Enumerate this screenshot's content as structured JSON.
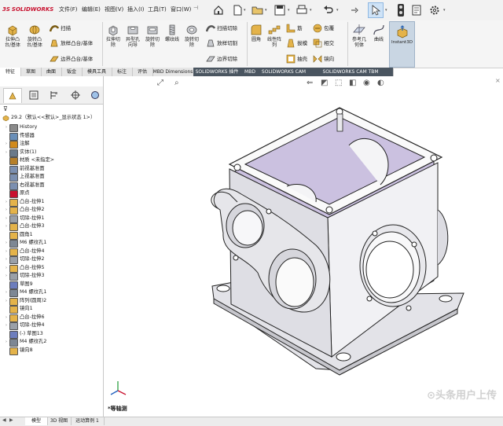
{
  "app": {
    "logo_text": "SOLIDWORKS",
    "logo_mark": "3S"
  },
  "menu": [
    "文件(F)",
    "编辑(E)",
    "视图(V)",
    "插入(I)",
    "工具(T)",
    "窗口(W)"
  ],
  "ribbon": {
    "groups": [
      {
        "label": "拉伸凸\n台/基体"
      },
      {
        "label": "旋转凸\n台/基体"
      },
      {
        "label": "扫描"
      },
      {
        "label": "放样凸台/基体"
      },
      {
        "label": "边界凸台/基体"
      },
      {
        "label": "拉伸切\n除"
      },
      {
        "label": "异型孔\n向导"
      },
      {
        "label": "旋转切\n除"
      },
      {
        "label": "螺纹线"
      },
      {
        "label": "旋转切\n除"
      },
      {
        "label": "扫描切除"
      },
      {
        "label": "放样切割"
      },
      {
        "label": "边界切除"
      },
      {
        "label": "圆角"
      },
      {
        "label": "线性阵\n列"
      },
      {
        "label": "筋"
      },
      {
        "label": "拔模"
      },
      {
        "label": "抽壳"
      },
      {
        "label": "包覆"
      },
      {
        "label": "相交"
      },
      {
        "label": "镜向"
      },
      {
        "label": "参考几\n何体"
      },
      {
        "label": "曲线"
      },
      {
        "label": "Instant3D"
      }
    ]
  },
  "tabs": [
    "特征",
    "草图",
    "曲面",
    "钣金",
    "模具工具",
    "标注",
    "评估",
    "MBD Dimensions",
    "SOLIDWORKS 插件",
    "MBD",
    "SOLIDWORKS CAM",
    "SOLIDWORKS CAM TBM"
  ],
  "tree": {
    "root": "29.2（默认<<默认>_显示状态 1>）",
    "items": [
      {
        "label": "History",
        "icon": "history-icon",
        "exp": "›"
      },
      {
        "label": "传感器",
        "icon": "sensor-icon",
        "exp": ""
      },
      {
        "label": "注解",
        "icon": "annotation-icon",
        "exp": "›"
      },
      {
        "label": "实体(1)",
        "icon": "solid-bodies-icon",
        "exp": "›"
      },
      {
        "label": "材质 <未指定>",
        "icon": "material-icon",
        "exp": ""
      },
      {
        "label": "前视基准面",
        "icon": "plane-icon",
        "exp": ""
      },
      {
        "label": "上视基准面",
        "icon": "plane-icon",
        "exp": ""
      },
      {
        "label": "右视基准面",
        "icon": "plane-icon",
        "exp": ""
      },
      {
        "label": "原点",
        "icon": "origin-icon",
        "exp": ""
      },
      {
        "label": "凸台-拉伸1",
        "icon": "extrude-icon",
        "exp": "›"
      },
      {
        "label": "凸台-拉伸2",
        "icon": "extrude-icon",
        "exp": "›"
      },
      {
        "label": "切除-拉伸1",
        "icon": "cut-icon",
        "exp": "›"
      },
      {
        "label": "凸台-拉伸3",
        "icon": "extrude-icon",
        "exp": "›"
      },
      {
        "label": "圆角1",
        "icon": "fillet-icon",
        "exp": ""
      },
      {
        "label": "M6 螺纹孔1",
        "icon": "hole-icon",
        "exp": "›"
      },
      {
        "label": "凸台-拉伸4",
        "icon": "extrude-icon",
        "exp": "›"
      },
      {
        "label": "切除-拉伸2",
        "icon": "cut-icon",
        "exp": "›"
      },
      {
        "label": "凸台-拉伸5",
        "icon": "extrude-icon",
        "exp": "›"
      },
      {
        "label": "切除-拉伸3",
        "icon": "cut-icon",
        "exp": "›"
      },
      {
        "label": "草图9",
        "icon": "sketch-icon",
        "exp": ""
      },
      {
        "label": "M4 螺纹孔1",
        "icon": "hole-icon",
        "exp": "›"
      },
      {
        "label": "阵列(圆周)2",
        "icon": "pattern-icon",
        "exp": "›"
      },
      {
        "label": "镜向1",
        "icon": "mirror-icon",
        "exp": ""
      },
      {
        "label": "凸台-拉伸6",
        "icon": "extrude-icon",
        "exp": "›"
      },
      {
        "label": "切除-拉伸4",
        "icon": "cut-icon",
        "exp": "›"
      },
      {
        "label": "(-) 草图13",
        "icon": "sketch-icon",
        "exp": ""
      },
      {
        "label": "M4 螺纹孔2",
        "icon": "hole-icon",
        "exp": "›"
      },
      {
        "label": "镜向8",
        "icon": "mirror-icon",
        "exp": ""
      }
    ]
  },
  "viewport": {
    "view_label": "*等轴测"
  },
  "bottom_tabs": [
    "模型",
    "3D 视图",
    "运动算例 1"
  ],
  "watermark": "⊙头条用户上传",
  "colors": {
    "accent": "#c8102e",
    "tab_dark": "#4a5560",
    "face_inner": "#cbc1e0",
    "face_light": "#f4f4f6",
    "face_mid": "#dcdce2",
    "edge": "#222222"
  }
}
